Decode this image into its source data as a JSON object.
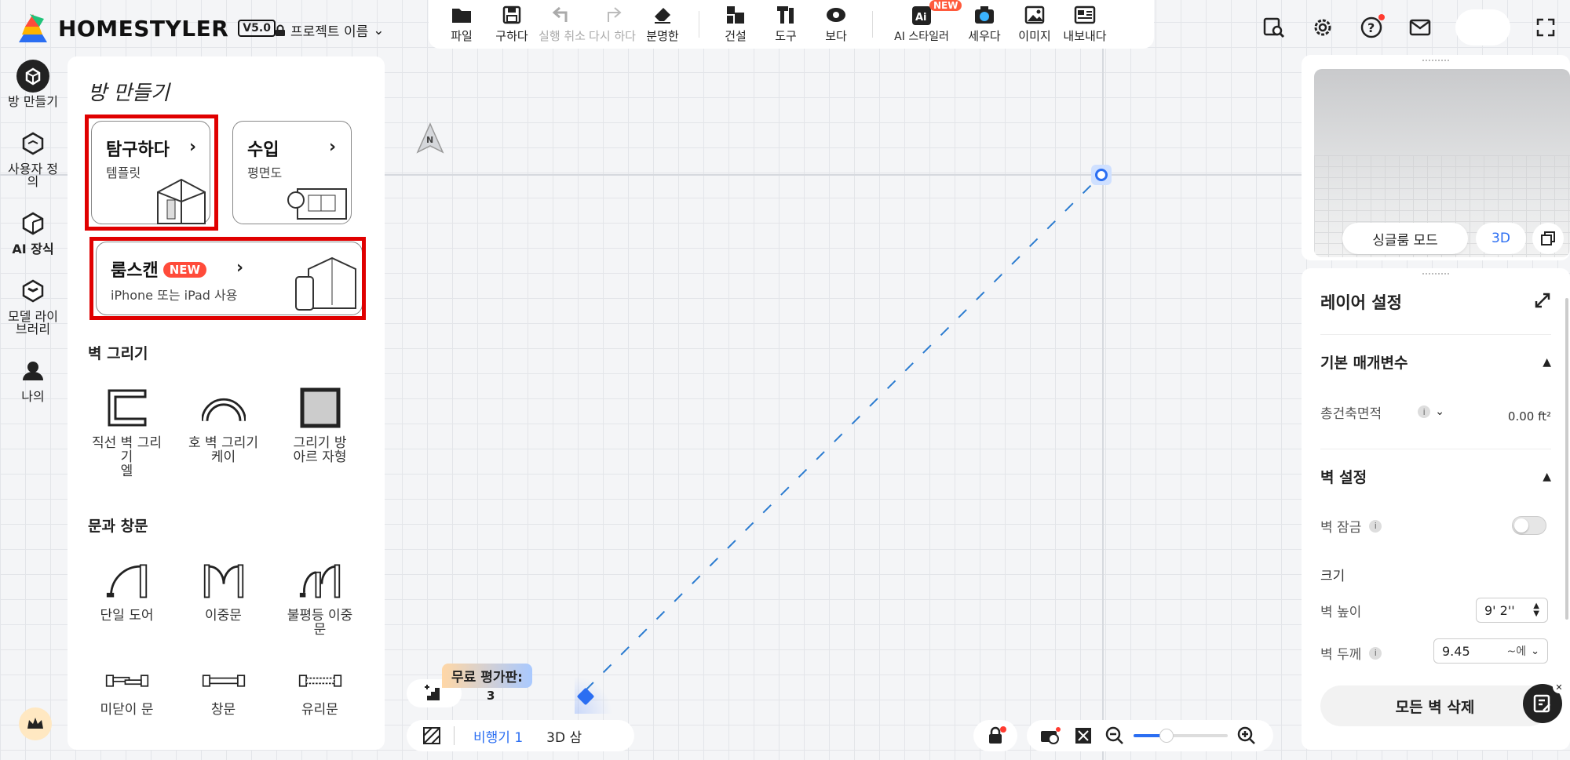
{
  "app": {
    "logo_text": "HOMESTYLER",
    "version": "V5.0",
    "project_name": "프로젝트 이름"
  },
  "toolbar": {
    "items": [
      {
        "label": "파일",
        "icon": "folder-icon"
      },
      {
        "label": "구하다",
        "icon": "save-icon"
      },
      {
        "label": "실행 취소",
        "icon": "undo-icon"
      },
      {
        "label": "다시 하다",
        "icon": "redo-icon"
      },
      {
        "label": "분명한",
        "icon": "eraser-icon"
      },
      {
        "label": "건설",
        "icon": "build-icon"
      },
      {
        "label": "도구",
        "icon": "tools-icon"
      },
      {
        "label": "보다",
        "icon": "eye-icon"
      },
      {
        "label": "AI 스타일러",
        "icon": "ai-styler-icon"
      },
      {
        "label": "세우다",
        "icon": "camera-icon"
      },
      {
        "label": "이미지",
        "icon": "image-icon"
      },
      {
        "label": "내보내다",
        "icon": "export-icon"
      }
    ],
    "new_badge": "NEW"
  },
  "rail": {
    "items": [
      {
        "label": "방 만들기",
        "icon": "create-room-icon"
      },
      {
        "label": "사용자 정의",
        "icon": "customize-icon"
      },
      {
        "label": "AI 장식",
        "icon": "ai-decor-icon"
      },
      {
        "label": "모델 라이브러리",
        "icon": "model-library-icon"
      },
      {
        "label": "나의",
        "icon": "my-icon"
      }
    ]
  },
  "panel": {
    "title": "방 만들기",
    "explore": {
      "title": "탐구하다",
      "subtitle": "템플릿"
    },
    "import": {
      "title": "수입",
      "subtitle": "평면도"
    },
    "roomscan": {
      "title": "룸스캔",
      "badge": "NEW",
      "subtitle": "iPhone 또는 iPad 사용"
    },
    "wall_section": "벽 그리기",
    "walls": [
      {
        "label": "직선 벽 그리기\n엘"
      },
      {
        "label": "호 벽 그리기\n케이"
      },
      {
        "label": "그리기 방\n아르 자형"
      }
    ],
    "door_section": "문과 창문",
    "doors": [
      {
        "label": "단일 도어"
      },
      {
        "label": "이중문"
      },
      {
        "label": "불평등 이중\n문"
      }
    ],
    "windows": [
      {
        "label": "미닫이 문"
      },
      {
        "label": "창문"
      },
      {
        "label": "유리문"
      }
    ]
  },
  "canvas": {
    "compass": "N",
    "free_tag": "무료 평가판:",
    "stair_count": "3",
    "floor_label": "비행기 1",
    "view_label": "3D 삼",
    "zoom_level": 0.35
  },
  "preview": {
    "single_room": "싱글룸 모드",
    "mode_3d": "3D"
  },
  "layer": {
    "title": "레이어 설정",
    "basic_params": "기본 매개변수",
    "total_area_label": "총건축면적",
    "total_area_value": "0.00 ft²",
    "wall_settings": "벽 설정",
    "wall_lock": "벽 잠금",
    "size_label": "크기",
    "wall_height_label": "벽 높이",
    "wall_height_value": "9' 2''",
    "wall_thickness_label": "벽 두께",
    "wall_thickness_value": "9.45",
    "wall_thickness_unit": "~에",
    "delete_all": "모든 벽 삭제"
  },
  "colors": {
    "accent": "#2b6ef2",
    "highlight": "#e00000",
    "new_badge": "#ff4b3a"
  }
}
